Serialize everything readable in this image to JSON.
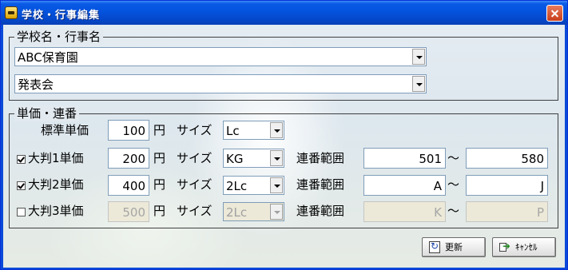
{
  "window": {
    "title": "学校・行事編集"
  },
  "school_group": {
    "label": "学校名・行事名",
    "school": "ABC保育園",
    "event": "発表会"
  },
  "price_group": {
    "label": "単価・連番",
    "labels": {
      "yen": "円",
      "size": "サイズ",
      "range": "連番範囲",
      "tilde": "～"
    },
    "standard": {
      "label": "標準単価",
      "price": "100",
      "size": "Lc"
    },
    "rows": [
      {
        "label": "大判1単価",
        "checked": true,
        "price": "200",
        "size": "KG",
        "range_from": "501",
        "range_to": "580",
        "enabled": true
      },
      {
        "label": "大判2単価",
        "checked": true,
        "price": "400",
        "size": "2Lc",
        "range_from": "A",
        "range_to": "J",
        "enabled": true
      },
      {
        "label": "大判3単価",
        "checked": false,
        "price": "500",
        "size": "2Lc",
        "range_from": "K",
        "range_to": "P",
        "enabled": false
      }
    ]
  },
  "buttons": {
    "update": "更新",
    "cancel": "ｷｬﾝｾﾙ"
  }
}
